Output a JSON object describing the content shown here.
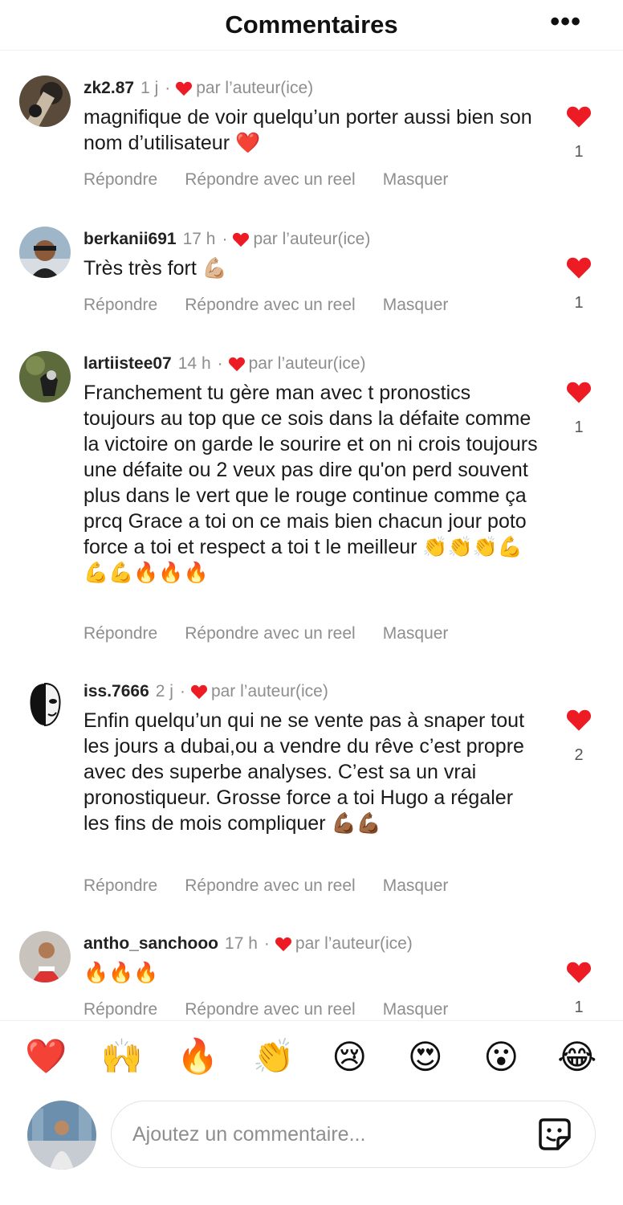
{
  "header": {
    "title": "Commentaires",
    "more": "•••"
  },
  "comments": [
    {
      "username": "zk2.87",
      "time": "1 j",
      "dot": "·",
      "liked_by": "par l’auteur(ice)",
      "text": "magnifique de voir quelqu’un porter aussi bien son nom d’utilisateur ❤️",
      "like_count": "1"
    },
    {
      "username": "berkanii691",
      "time": "17 h",
      "dot": "·",
      "liked_by": "par l’auteur(ice)",
      "text": "Très très fort 💪🏼",
      "like_count": "1"
    },
    {
      "username": "lartiistee07",
      "time": "14 h",
      "dot": "·",
      "liked_by": "par l’auteur(ice)",
      "text": "Franchement tu gère man avec t pronostics toujours au top que ce sois dans la défaite comme la victoire on garde le sourire et on ni crois toujours une défaite ou 2 veux pas dire qu'on perd souvent plus dans le vert que le rouge continue comme ça prcq Grace a toi on ce mais bien chacun jour poto force a toi et respect a toi t le meilleur 👏👏👏💪💪💪🔥🔥🔥",
      "like_count": "1"
    },
    {
      "username": "iss.7666",
      "time": "2 j",
      "dot": "·",
      "liked_by": "par l’auteur(ice)",
      "text": "Enfin quelqu’un qui ne se vente pas à snaper tout les jours a dubai,ou a vendre du rêve c’est propre avec des superbe analyses. C’est sa un vrai pronostiqueur. Grosse force a toi Hugo a régaler les fins de mois compliquer 💪🏾💪🏾",
      "like_count": "2"
    },
    {
      "username": "antho_sanchooo",
      "time": "17 h",
      "dot": "·",
      "liked_by": "par l’auteur(ice)",
      "text": "🔥🔥🔥",
      "like_count": "1"
    }
  ],
  "actions": {
    "reply": "Répondre",
    "reply_reel": "Répondre avec un reel",
    "hide": "Masquer"
  },
  "reactions": [
    "❤️",
    "🙌",
    "🔥",
    "👏",
    "😢",
    "😍",
    "😮",
    "😂"
  ],
  "composer": {
    "placeholder": "Ajoutez un commentaire..."
  },
  "colors": {
    "like_red": "#ED1C24",
    "muted": "#8E8E8E"
  },
  "icons": {
    "like": "heart-icon",
    "more": "more-horizontal-icon",
    "sticker": "sticker-icon"
  }
}
